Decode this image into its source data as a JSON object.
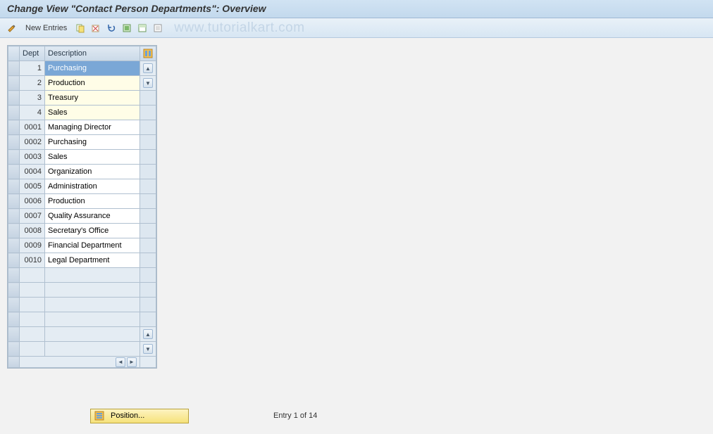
{
  "title": "Change View \"Contact Person Departments\": Overview",
  "toolbar": {
    "new_entries_label": "New Entries"
  },
  "watermark": "www.tutorialkart.com",
  "table": {
    "headers": {
      "dept": "Dept",
      "description": "Description"
    },
    "rows": [
      {
        "dept": "1",
        "description": "Purchasing",
        "editable": true,
        "selected": true
      },
      {
        "dept": "2",
        "description": "Production",
        "editable": true,
        "selected": false
      },
      {
        "dept": "3",
        "description": "Treasury",
        "editable": true,
        "selected": false
      },
      {
        "dept": "4",
        "description": "Sales",
        "editable": true,
        "selected": false
      },
      {
        "dept": "0001",
        "description": "Managing Director",
        "editable": false,
        "selected": false
      },
      {
        "dept": "0002",
        "description": "Purchasing",
        "editable": false,
        "selected": false
      },
      {
        "dept": "0003",
        "description": "Sales",
        "editable": false,
        "selected": false
      },
      {
        "dept": "0004",
        "description": "Organization",
        "editable": false,
        "selected": false
      },
      {
        "dept": "0005",
        "description": "Administration",
        "editable": false,
        "selected": false
      },
      {
        "dept": "0006",
        "description": "Production",
        "editable": false,
        "selected": false
      },
      {
        "dept": "0007",
        "description": "Quality Assurance",
        "editable": false,
        "selected": false
      },
      {
        "dept": "0008",
        "description": "Secretary's Office",
        "editable": false,
        "selected": false
      },
      {
        "dept": "0009",
        "description": "Financial Department",
        "editable": false,
        "selected": false
      },
      {
        "dept": "0010",
        "description": "Legal Department",
        "editable": false,
        "selected": false
      }
    ],
    "empty_rows": 6
  },
  "footer": {
    "position_label": "Position...",
    "entry_status": "Entry 1 of 14"
  },
  "colors": {
    "header_grad_top": "#d1e3f3",
    "header_grad_bottom": "#c3d9ed",
    "toolbar_grad_top": "#e9f1f8",
    "toolbar_grad_bottom": "#d7e6f3",
    "selection_bg": "#7aa7d6",
    "editable_bg": "#fffde7",
    "position_btn_bg": "#f6e27a"
  }
}
